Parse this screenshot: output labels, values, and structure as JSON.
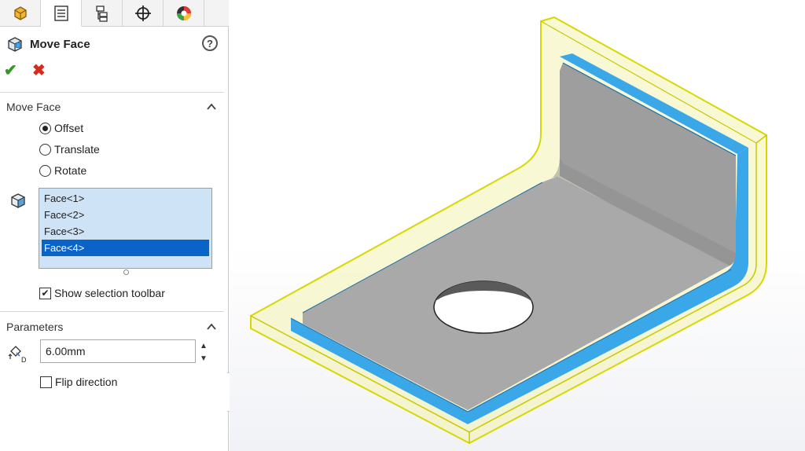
{
  "tabs": [
    {
      "name": "feature-manager",
      "icon": "feature-tree-icon"
    },
    {
      "name": "property-manager",
      "icon": "property-manager-icon"
    },
    {
      "name": "configuration-manager",
      "icon": "configuration-icon"
    },
    {
      "name": "dimxpert-manager",
      "icon": "crosshair-icon"
    },
    {
      "name": "display-manager",
      "icon": "appearance-icon"
    }
  ],
  "property_manager": {
    "title": "Move Face",
    "help_label": "?",
    "ok_icon": "checkmark-icon",
    "cancel_icon": "close-icon"
  },
  "move_face_group": {
    "title": "Move Face",
    "options": [
      {
        "label": "Offset",
        "checked": true
      },
      {
        "label": "Translate",
        "checked": false
      },
      {
        "label": "Rotate",
        "checked": false
      }
    ],
    "faces": [
      "Face<1>",
      "Face<2>",
      "Face<3>",
      "Face<4>"
    ],
    "selected_face_index": 3,
    "show_selection_toolbar": {
      "label": "Show selection toolbar",
      "checked": true
    }
  },
  "parameters_group": {
    "title": "Parameters",
    "distance_value": "6.00mm",
    "flip_direction": {
      "label": "Flip direction",
      "checked": false
    }
  },
  "colors": {
    "selection_blue": "#3aa8e8",
    "preview_yellow": "#e8e86a",
    "model_gray": "#a9a9a9"
  }
}
